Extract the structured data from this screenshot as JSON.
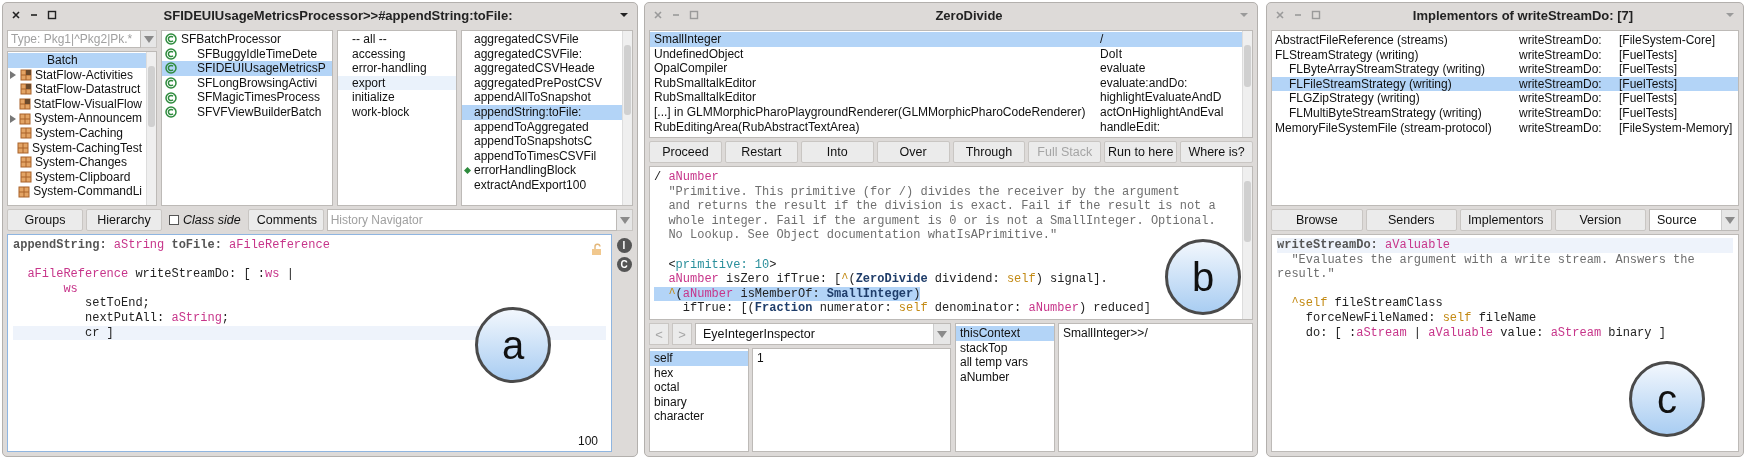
{
  "browser": {
    "title": "SFIDEUIUsageMetricsProcessor>>#appendString:toFile:",
    "active": true,
    "package_filter": {
      "placeholder": "Type: Pkg1|^Pkg2|Pk.*"
    },
    "packages": [
      {
        "label": "Batch",
        "kind": "tag",
        "expandable": false,
        "selected": true
      },
      {
        "label": "StatFlow-Activities",
        "kind": "package",
        "expandable": true,
        "modified": true,
        "selected": false
      },
      {
        "label": "StatFlow-Datastruct",
        "kind": "package",
        "expandable": false,
        "modified": true,
        "selected": false
      },
      {
        "label": "StatFlow-VisualFlow",
        "kind": "package",
        "expandable": false,
        "modified": true,
        "selected": false
      },
      {
        "label": "System-Announcem",
        "kind": "package",
        "expandable": true,
        "modified": false,
        "selected": false
      },
      {
        "label": "System-Caching",
        "kind": "package",
        "expandable": false,
        "modified": false,
        "selected": false
      },
      {
        "label": "System-CachingTest",
        "kind": "package",
        "expandable": false,
        "modified": false,
        "selected": false
      },
      {
        "label": "System-Changes",
        "kind": "package",
        "expandable": false,
        "modified": false,
        "selected": false
      },
      {
        "label": "System-Clipboard",
        "kind": "package",
        "expandable": false,
        "modified": false,
        "selected": false
      },
      {
        "label": "System-CommandLi",
        "kind": "package",
        "expandable": false,
        "modified": false,
        "selected": false
      }
    ],
    "classes": [
      {
        "label": "SFBatchProcessor",
        "selected": false,
        "children": [
          {
            "label": "SFBuggyIdleTimeDete",
            "selected": false
          },
          {
            "label": "SFIDEUIUsageMetricsP",
            "selected": true
          },
          {
            "label": "SFLongBrowsingActivi",
            "selected": false
          },
          {
            "label": "SFMagicTimesProcess",
            "selected": false
          },
          {
            "label": "SFVFViewBuilderBatch",
            "selected": false
          }
        ]
      }
    ],
    "protocols": [
      {
        "label": "-- all --",
        "selected": false
      },
      {
        "label": "accessing",
        "selected": false
      },
      {
        "label": "error-handling",
        "selected": false
      },
      {
        "label": "export",
        "selected": true
      },
      {
        "label": "initialize",
        "selected": false
      },
      {
        "label": "work-block",
        "selected": false
      }
    ],
    "methods": [
      {
        "label": "aggregatedCSVFile",
        "overrides": false,
        "selected": false
      },
      {
        "label": "aggregatedCSVFile:",
        "overrides": false,
        "selected": false
      },
      {
        "label": "aggregatedCSVHeade",
        "overrides": false,
        "selected": false
      },
      {
        "label": "aggregatedPrePostCSV",
        "overrides": false,
        "selected": false
      },
      {
        "label": "appendAllToSnapshot",
        "overrides": false,
        "selected": false
      },
      {
        "label": "appendString:toFile:",
        "overrides": false,
        "selected": true
      },
      {
        "label": "appendToAggregated",
        "overrides": false,
        "selected": false
      },
      {
        "label": "appendToSnapshotsC",
        "overrides": false,
        "selected": false
      },
      {
        "label": "appendToTimesCSVFil",
        "overrides": false,
        "selected": false
      },
      {
        "label": "errorHandlingBlock",
        "overrides": true,
        "selected": false
      },
      {
        "label": "extractAndExport100",
        "overrides": false,
        "selected": false
      }
    ],
    "toolbar": [
      {
        "kind": "button",
        "label": "Groups"
      },
      {
        "kind": "button",
        "label": "Hierarchy"
      },
      {
        "kind": "checkbox",
        "label": "Class side",
        "checked": false
      },
      {
        "kind": "button",
        "label": "Comments"
      }
    ],
    "history": {
      "placeholder": "History Navigator"
    },
    "code": [
      {
        "current": false,
        "selected": false,
        "tokens": [
          {
            "text": "appendString: ",
            "kind": "header"
          },
          {
            "text": "aString",
            "kind": "arg"
          },
          {
            "text": " toFile: ",
            "kind": "header"
          },
          {
            "text": "aFileReference",
            "kind": "arg"
          }
        ]
      },
      {
        "current": false,
        "selected": false
      },
      {
        "current": false,
        "selected": false,
        "tokens": [
          {
            "text": "  aFileReference",
            "kind": "arg"
          },
          {
            "text": " writeStreamDo: [ :",
            "kind": "plain"
          },
          {
            "text": "ws",
            "kind": "arg"
          },
          {
            "text": " |",
            "kind": "plain"
          }
        ]
      },
      {
        "current": false,
        "selected": false,
        "tokens": [
          {
            "text": "       ws",
            "kind": "arg"
          }
        ]
      },
      {
        "current": false,
        "selected": false,
        "tokens": [
          {
            "text": "          setToEnd;",
            "kind": "plain"
          }
        ]
      },
      {
        "current": false,
        "selected": false,
        "tokens": [
          {
            "text": "          nextPutAll: ",
            "kind": "plain"
          },
          {
            "text": "aString",
            "kind": "arg"
          },
          {
            "text": ";",
            "kind": "plain"
          }
        ]
      },
      {
        "current": true,
        "selected": false,
        "tokens": [
          {
            "text": "          cr ]",
            "kind": "plain"
          }
        ]
      }
    ],
    "side_buttons": [
      "I",
      "C"
    ],
    "status": "100",
    "marker": "a"
  },
  "debugger": {
    "title": "ZeroDivide",
    "active": false,
    "stack": [
      {
        "receiver": "SmallInteger",
        "method": "/",
        "selected": true
      },
      {
        "receiver": "UndefinedObject",
        "method": "DoIt",
        "selected": false
      },
      {
        "receiver": "OpalCompiler",
        "method": "evaluate",
        "selected": false
      },
      {
        "receiver": "RubSmalltalkEditor",
        "method": "evaluate:andDo:",
        "selected": false
      },
      {
        "receiver": "RubSmalltalkEditor",
        "method": "highlightEvaluateAndD",
        "selected": false
      },
      {
        "receiver": "[...] in GLMMorphicPharoPlaygroundRenderer(GLMMorphicPharoCodeRenderer)",
        "method": "actOnHighlightAndEval",
        "selected": false
      },
      {
        "receiver": "RubEditingArea(RubAbstractTextArea)",
        "method": "handleEdit:",
        "selected": false
      }
    ],
    "buttons": [
      {
        "label": "Proceed",
        "disabled": false
      },
      {
        "label": "Restart",
        "disabled": false
      },
      {
        "label": "Into",
        "disabled": false
      },
      {
        "label": "Over",
        "disabled": false
      },
      {
        "label": "Through",
        "disabled": false
      },
      {
        "label": "Full Stack",
        "disabled": true
      },
      {
        "label": "Run to here",
        "disabled": false
      },
      {
        "label": "Where is?",
        "disabled": false
      }
    ],
    "code": [
      {
        "current": false,
        "selected": false,
        "tokens": [
          {
            "text": "/ ",
            "kind": "plain"
          },
          {
            "text": "aNumber",
            "kind": "arg"
          }
        ]
      },
      {
        "current": false,
        "selected": false,
        "tokens": [
          {
            "text": "  \"Primitive. This primitive (for /) divides the receiver by the argument",
            "kind": "comment"
          }
        ]
      },
      {
        "current": false,
        "selected": false,
        "tokens": [
          {
            "text": "  and returns the result if the division is exact. Fail if the result is not a",
            "kind": "comment"
          }
        ]
      },
      {
        "current": false,
        "selected": false,
        "tokens": [
          {
            "text": "  whole integer. Fail if the argument is 0 or is not a SmallInteger. Optional.",
            "kind": "comment"
          }
        ]
      },
      {
        "current": false,
        "selected": false,
        "tokens": [
          {
            "text": "  No Lookup. See Object documentation whatIsAPrimitive.\"",
            "kind": "comment"
          }
        ]
      },
      {
        "current": false,
        "selected": false
      },
      {
        "current": false,
        "selected": false,
        "tokens": [
          {
            "text": "  <",
            "kind": "plain"
          },
          {
            "text": "primitive: 10",
            "kind": "pragma"
          },
          {
            "text": ">",
            "kind": "plain"
          }
        ]
      },
      {
        "current": false,
        "selected": false,
        "tokens": [
          {
            "text": "  aNumber",
            "kind": "arg"
          },
          {
            "text": " isZero ifTrue: [",
            "kind": "plain"
          },
          {
            "text": "^",
            "kind": "selfref"
          },
          {
            "text": "(",
            "kind": "plain"
          },
          {
            "text": "ZeroDivide",
            "kind": "classref"
          },
          {
            "text": " dividend: ",
            "kind": "plain"
          },
          {
            "text": "self",
            "kind": "selfref"
          },
          {
            "text": ") signal].",
            "kind": "plain"
          }
        ]
      },
      {
        "current": false,
        "selected": true,
        "tokens": [
          {
            "text": "  ^",
            "kind": "selfref"
          },
          {
            "text": "(",
            "kind": "plain"
          },
          {
            "text": "aNumber",
            "kind": "arg"
          },
          {
            "text": " isMemberOf: ",
            "kind": "plain"
          },
          {
            "text": "SmallInteger",
            "kind": "classref"
          },
          {
            "text": ")",
            "kind": "plain"
          }
        ]
      },
      {
        "current": false,
        "selected": false,
        "tokens": [
          {
            "text": "    ifTrue: [(",
            "kind": "plain"
          },
          {
            "text": "Fraction",
            "kind": "classref"
          },
          {
            "text": " numerator: ",
            "kind": "plain"
          },
          {
            "text": "self",
            "kind": "selfref"
          },
          {
            "text": " denominator: ",
            "kind": "plain"
          },
          {
            "text": "aNumber",
            "kind": "arg"
          },
          {
            "text": ") reduced]",
            "kind": "plain"
          }
        ]
      }
    ],
    "nav_buttons": [
      {
        "label": "<",
        "disabled": true
      },
      {
        "label": ">",
        "disabled": true
      }
    ],
    "inspector": {
      "type": "EyeIntegerInspector",
      "fields": [
        {
          "label": "self",
          "selected": true
        },
        {
          "label": "hex",
          "selected": false
        },
        {
          "label": "octal",
          "selected": false
        },
        {
          "label": "binary",
          "selected": false
        },
        {
          "label": "character",
          "selected": false
        }
      ],
      "value": "1"
    },
    "context": {
      "fields": [
        {
          "label": "thisContext",
          "selected": true
        },
        {
          "label": "stackTop",
          "selected": false
        },
        {
          "label": "all temp vars",
          "selected": false
        },
        {
          "label": "aNumber",
          "selected": false
        }
      ],
      "value": "SmallInteger>>/"
    },
    "marker": "b"
  },
  "implementors": {
    "title": "Implementors of writeStreamDo: [7]",
    "active": false,
    "results": [
      {
        "class": "AbstractFileReference (streams)",
        "selector": "writeStreamDo:",
        "package": "[FileSystem-Core]",
        "selected": false
      },
      {
        "class": "FLStreamStrategy (writing)",
        "selector": "writeStreamDo:",
        "package": "[FuelTests]",
        "selected": false,
        "children": [
          {
            "class": "FLByteArrayStreamStrategy (writing)",
            "selector": "writeStreamDo:",
            "package": "[FuelTests]",
            "selected": false
          },
          {
            "class": "FLFileStreamStrategy (writing)",
            "selector": "writeStreamDo:",
            "package": "[FuelTests]",
            "selected": true
          },
          {
            "class": "FLGZipStrategy (writing)",
            "selector": "writeStreamDo:",
            "package": "[FuelTests]",
            "selected": false
          },
          {
            "class": "FLMultiByteStreamStrategy (writing)",
            "selector": "writeStreamDo:",
            "package": "[FuelTests]",
            "selected": false
          }
        ]
      },
      {
        "class": "MemoryFileSystemFile (stream-protocol)",
        "selector": "writeStreamDo:",
        "package": "[FileSystem-Memory]",
        "selected": false
      }
    ],
    "buttons": [
      "Browse",
      "Senders",
      "Implementors",
      "Version"
    ],
    "mode": "Source",
    "code": [
      {
        "current": true,
        "selected": false,
        "tokens": [
          {
            "text": "writeStreamDo: ",
            "kind": "header"
          },
          {
            "text": "aValuable",
            "kind": "arg"
          }
        ]
      },
      {
        "current": false,
        "selected": false,
        "tokens": [
          {
            "text": "  \"Evaluates the argument with a write stream. Answers the",
            "kind": "comment"
          }
        ]
      },
      {
        "current": false,
        "selected": false,
        "tokens": [
          {
            "text": "result.\"",
            "kind": "comment"
          }
        ]
      },
      {
        "current": false,
        "selected": false
      },
      {
        "current": false,
        "selected": false,
        "tokens": [
          {
            "text": "  ^self",
            "kind": "selfref"
          },
          {
            "text": " fileStreamClass",
            "kind": "plain"
          }
        ]
      },
      {
        "current": false,
        "selected": false,
        "tokens": [
          {
            "text": "    forceNewFileNamed: ",
            "kind": "plain"
          },
          {
            "text": "self",
            "kind": "selfref"
          },
          {
            "text": " fileName",
            "kind": "plain"
          }
        ]
      },
      {
        "current": false,
        "selected": false,
        "tokens": [
          {
            "text": "    do: [ :",
            "kind": "plain"
          },
          {
            "text": "aStream",
            "kind": "arg"
          },
          {
            "text": " | ",
            "kind": "plain"
          },
          {
            "text": "aValuable",
            "kind": "arg"
          },
          {
            "text": " value: ",
            "kind": "plain"
          },
          {
            "text": "aStream",
            "kind": "arg"
          },
          {
            "text": " binary ]",
            "kind": "plain"
          }
        ]
      }
    ],
    "marker": "c"
  }
}
